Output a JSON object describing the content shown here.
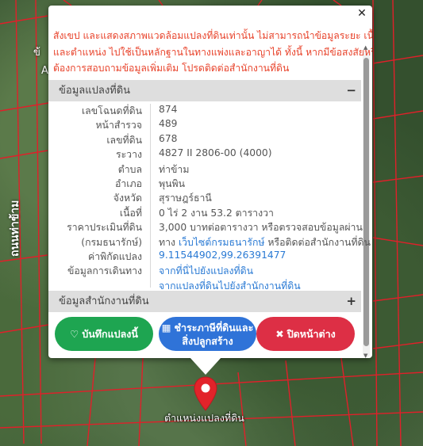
{
  "map": {
    "road_label": "ถนนท่าข้าม",
    "marker_label": "ตำแหน่งแปลงที่ดิน",
    "fragment_a": "ข้",
    "fragment_b": "A",
    "parcel_line_color": "#e0202a"
  },
  "popup": {
    "warning_lines": [
      "สังเขป และแสดงสภาพแวดล้อมแปลงที่ดินเท่านั้น ไม่สามารถนำข้อมูลระยะ เนื้อที่",
      "และตำแหน่ง ไปใช้เป็นหลักฐานในทางแพ่งและอาญาได้ ทั้งนี้ หากมีข้อสงสัยหรือ",
      "ต้องการสอบถามข้อมูลเพิ่มเติม โปรดติดต่อสำนักงานที่ดิน"
    ],
    "section1_title": "ข้อมูลแปลงที่ดิน",
    "section1_sign": "−",
    "section2_title": "ข้อมูลสำนักงานที่ดิน",
    "section2_sign": "+",
    "fields": {
      "deed_label": "เลขโฉนดที่ดิน",
      "deed": "874",
      "survey_label": "หน้าสำรวจ",
      "survey": "489",
      "parcel_label": "เลขที่ดิน",
      "parcel": "678",
      "sheet_label": "ระวาง",
      "sheet": "4827 II 2806-00 (4000)",
      "subdistrict_label": "ตำบล",
      "subdistrict": "ท่าข้าม",
      "district_label": "อำเภอ",
      "district": "พุนพิน",
      "province_label": "จังหวัด",
      "province": "สุราษฎร์ธานี",
      "area_label": "เนื้อที่",
      "area": "0 ไร่ 2 งาน 53.2 ตารางวา",
      "price_label": "ราคาประเมินที่ดิน",
      "price": "3,000 บาทต่อตารางวา หรือตรวจสอบข้อมูลผ่าน",
      "dept_label": "(กรมธนารักษ์)",
      "price2_prefix": "ทาง",
      "price2_link": "เว็บไซต์กรมธนารักษ์",
      "price2_suffix": "หรือติดต่อสำนักงานที่ดิน",
      "coord_label": "ค่าพิกัดแปลง",
      "coord": "9.11544902,99.26391477",
      "travel_label": "ข้อมูลการเดินทาง",
      "travel_link1": "จากที่นี่ไปยังแปลงที่ดิน",
      "travel_link2": "จากแปลงที่ดินไปยังสำนักงานที่ดิน"
    },
    "buttons": {
      "save": "บันทึกแปลงนี้",
      "pay_line1": "ชำระภาษีที่ดินและ",
      "pay_line2": "สิ่งปลูกสร้าง",
      "close": "ปิดหน้าต่าง"
    },
    "colors": {
      "warning": "#e8432b",
      "link": "#2a7ad4",
      "green": "#1ea551",
      "blue": "#2f73d8",
      "red": "#dd2f45"
    }
  }
}
